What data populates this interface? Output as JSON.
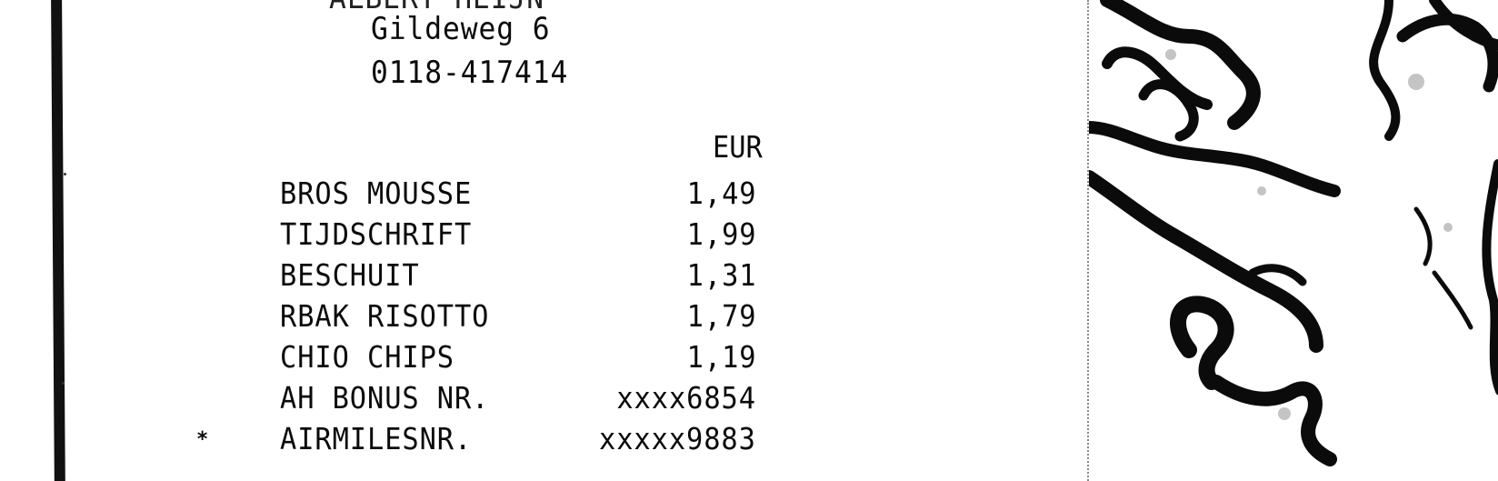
{
  "receipt": {
    "header_cut_text": "ALBERT HEIJN",
    "address": "Gildeweg 6",
    "phone": "0118-417414",
    "currency": "EUR",
    "lines": [
      {
        "marker": "",
        "name": "BROS MOUSSE",
        "value": "1,49"
      },
      {
        "marker": "",
        "name": "TIJDSCHRIFT",
        "value": "1,99"
      },
      {
        "marker": "",
        "name": "BESCHUIT",
        "value": "1,31"
      },
      {
        "marker": "",
        "name": "RBAK RISOTTO",
        "value": "1,79"
      },
      {
        "marker": "",
        "name": "CHIO CHIPS",
        "value": "1,19"
      },
      {
        "marker": "",
        "name": "AH BONUS NR.",
        "value": "xxxx6854"
      },
      {
        "marker": "*",
        "name": "AIRMILESNR.",
        "value": "xxxxx9883"
      }
    ]
  },
  "background_art": {
    "description_icon": "ink-doodle-icon"
  }
}
